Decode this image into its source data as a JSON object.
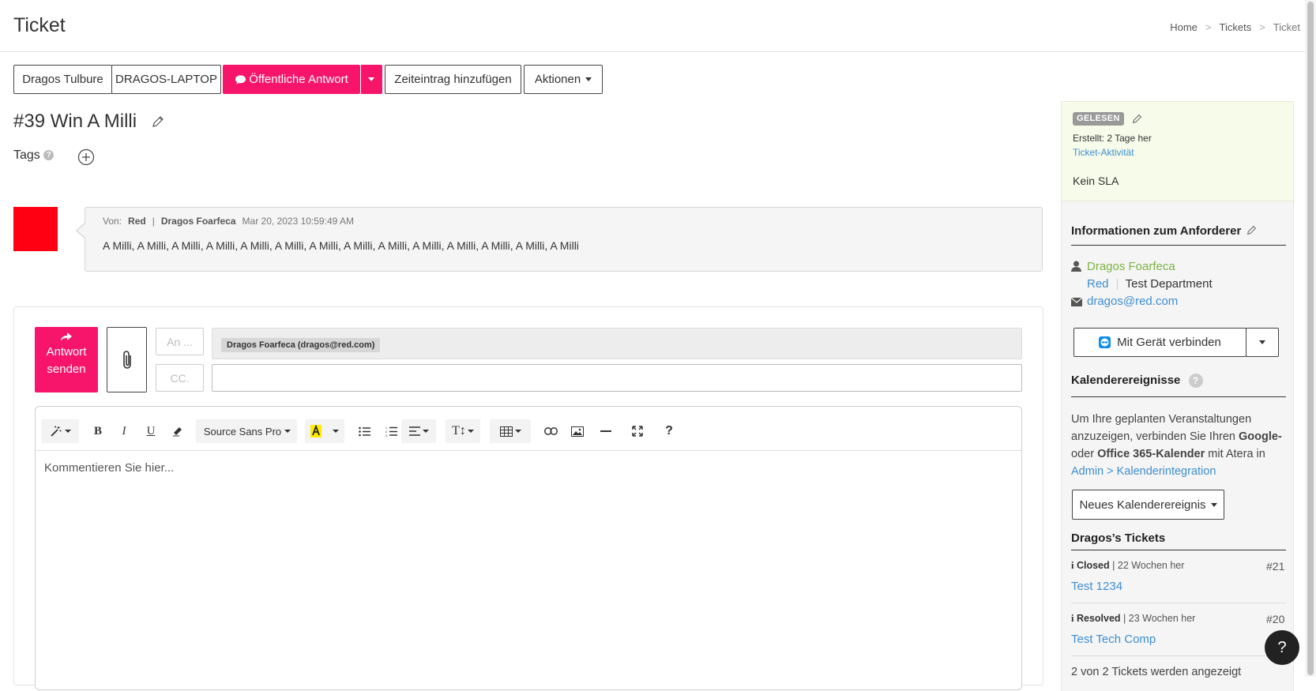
{
  "header": {
    "title": "Ticket",
    "breadcrumb": [
      "Home",
      "Tickets",
      "Ticket"
    ],
    "breadcrumb_sep": ">"
  },
  "toolbar": {
    "customer_label": "Dragos Tulbure",
    "device_label": "DRAGOS-LAPTOP",
    "public_reply_label": "Öffentliche Antwort",
    "time_entry_label": "Zeiteintrag hinzufügen",
    "actions_label": "Aktionen"
  },
  "ticket": {
    "title": "#39 Win A Milli",
    "tags_label": "Tags"
  },
  "message": {
    "from_label": "Von:",
    "from_company": "Red",
    "separator": "|",
    "from_person": "Dragos Foarfeca",
    "timestamp": "Mar 20, 2023 10:59:49 AM",
    "body": "A Milli, A Milli, A Milli, A Milli, A Milli, A Milli, A Milli, A Milli, A Milli, A Milli, A Milli, A Milli, A Milli, A Milli"
  },
  "reply": {
    "send_label_1": "Antwort",
    "send_label_2": "senden",
    "to_placeholder": "An ...",
    "cc_placeholder": "CC.",
    "recipient_chip": "Dragos Foarfeca (dragos@red.com)",
    "editor": {
      "font_name": "Source Sans Pro",
      "placeholder": "Kommentieren Sie hier..."
    }
  },
  "sidebar": {
    "status_badge": "GELESEN",
    "created": "Erstellt: 2 Tage her",
    "activity_link": "Ticket-Aktivität",
    "sla": "Kein SLA",
    "requester": {
      "title": "Informationen zum Anforderer",
      "name": "Dragos Foarfeca",
      "company": "Red",
      "department": "Test Department",
      "email": "dragos@red.com",
      "connect_label": "Mit Gerät verbinden"
    },
    "calendar": {
      "title": "Kalenderereignisse",
      "text_1": "Um Ihre geplanten Veranstaltungen",
      "text_2a": "anzuzeigen, verbinden Sie Ihren ",
      "text_2b": "Google-",
      "text_3a": "oder ",
      "text_3b": "Office 365-Kalender",
      "text_3c": " mit Atera in",
      "admin_link": "Admin > Kalenderintegration",
      "new_event_label": "Neues Kalenderereignis"
    },
    "tickets": {
      "title": "Dragos’s Tickets",
      "items": [
        {
          "status": "Closed",
          "age": "| 22 Wochen her",
          "number": "#21",
          "subject": "Test 1234"
        },
        {
          "status": "Resolved",
          "age": "| 23 Wochen her",
          "number": "#20",
          "subject": "Test Tech Comp"
        }
      ],
      "footer": "2 von 2 Tickets werden angezeigt"
    }
  },
  "help_fab": "?",
  "colors": {
    "accent": "#f7156b",
    "link": "#3e8ed0",
    "green_link": "#7cb342",
    "avatar": "#ff0013"
  }
}
